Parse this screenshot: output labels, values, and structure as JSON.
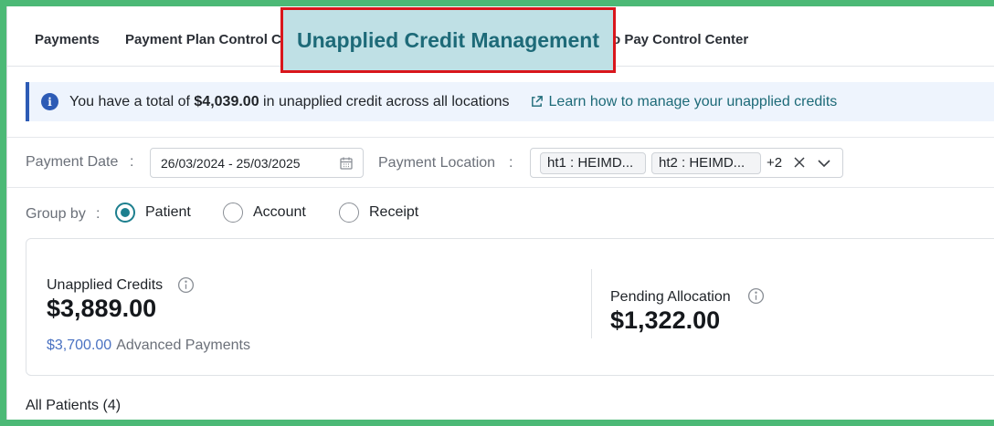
{
  "tabs": {
    "payments": "Payments",
    "payment_plan": "Payment Plan Control Center",
    "active": "Unapplied Credit Management",
    "pay_control": "o Pay Control Center"
  },
  "banner": {
    "text_before": "You have a total of ",
    "total": "$4,039.00",
    "text_after": " in unapplied credit across all locations",
    "link": "Learn how to manage your unapplied credits",
    "accent_color": "#2d5bb5"
  },
  "filters": {
    "payment_date_label": "Payment Date",
    "colon": ":",
    "payment_date_value": "26/03/2024 - 25/03/2025",
    "payment_location_label": "Payment Location",
    "location_chips": [
      "ht1 : HEIMD...",
      "ht2 : HEIMD..."
    ],
    "location_more": "+2"
  },
  "group_by": {
    "label": "Group by",
    "options": [
      "Patient",
      "Account",
      "Receipt"
    ],
    "selected": "Patient"
  },
  "summary": {
    "unapplied_label": "Unapplied Credits",
    "unapplied_value": "$3,889.00",
    "advanced_amount": "$3,700.00",
    "advanced_label": "Advanced Payments",
    "pending_label": "Pending Allocation",
    "pending_value": "$1,322.00"
  },
  "list": {
    "title": "All Patients (4)"
  },
  "colors": {
    "highlight_bg": "#bfe0e5",
    "highlight_border": "#d9161c",
    "teal": "#1d6a78",
    "frame": "#4cb976"
  }
}
